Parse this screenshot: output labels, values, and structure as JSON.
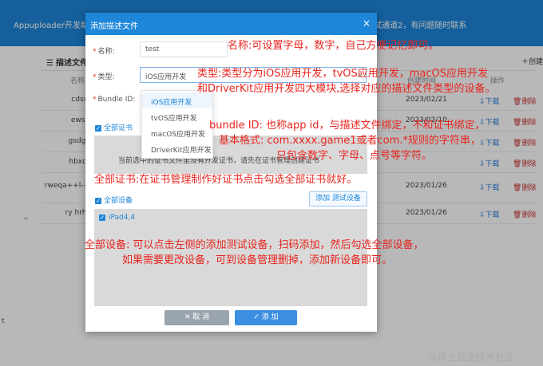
{
  "app": {
    "title": "Appuploader开发助",
    "notice": "试通道2，有问题随时联系"
  },
  "sidebar_toggle": "^",
  "stray_char": "t",
  "panel": {
    "title": "描述文件",
    "create_label": "＋创建",
    "columns": {
      "name": "名称",
      "created": "创建时间",
      "actions": "操作"
    },
    "rows": [
      {
        "name": "cdsw",
        "date": "2023/02/21",
        "download": "下载",
        "delete": "删除"
      },
      {
        "name": "ewse",
        "date": "2023/02/10",
        "download": "下载",
        "delete": "删除"
      },
      {
        "name": "gsdgs",
        "date": "",
        "download": "下载",
        "delete": "删除"
      },
      {
        "name": "hbxdf",
        "date": "",
        "download": "下载",
        "delete": "删除"
      },
      {
        "name": "rweqa++l-+",
        "date": "2023/01/26",
        "download": "下载",
        "delete": "删除"
      },
      {
        "name": "ry hrht",
        "date": "2023/01/26",
        "download": "下载",
        "delete": "删除"
      }
    ]
  },
  "dialog": {
    "title": "添加描述文件",
    "close_symbol": "×",
    "fields": {
      "name_label": "名称:",
      "name_value": "test",
      "type_label": "类型:",
      "type_value": "iOS应用开发",
      "bundle_label": "Bundle ID:"
    },
    "type_options": [
      "iOS应用开发",
      "tvOS应用开发",
      "macOS应用开发",
      "DriverKit应用开发"
    ],
    "all_certs_label": "全部证书",
    "cert_text": "当前选中的证书文件里没有开发证书，请先在证书管理创建证书",
    "all_devices_label": "全部设备",
    "add_device_button": "添加 测试设备",
    "devices": [
      "iPad4,4"
    ],
    "cancel_button": "✕ 取 消",
    "add_button": "✓ 添 加"
  },
  "annotations": {
    "name": "名称:可设置字母，数字，自己方便记忆即可。",
    "type_line1": "类型:类型分为iOS应用开发，tvOS应用开发，macOS应用开发",
    "type_line2": "和DriverKit应用开发四大模块,选择对应的描述文件类型的设备。",
    "bundle_line1": "bundle ID: 也称app id，与描述文件绑定，不和证书绑定，",
    "bundle_line2": "基本格式: com.xxxx.game1或者com.*规则的字符串，",
    "bundle_line3": "只包含数字、字母、点号等字符。",
    "cert": "全部证书:在证书管理制作好证书点击勾选全部证书就好。",
    "device_line1": "全部设备: 可以点击左侧的添加测试设备，扫码添加，然后勾选全部设备，",
    "device_line2": "如果需要更改设备，可到设备管理删掉，添加新设备即可。"
  },
  "watermark": "@稀土掘金技术社区",
  "colors": {
    "brand_blue": "#1e86d8",
    "annotation_red": "#e8251f",
    "delete_red": "#cc3333"
  },
  "icons": {
    "list": "list-icon",
    "download": "download-icon",
    "delete": "trash-icon",
    "close": "close-icon"
  }
}
